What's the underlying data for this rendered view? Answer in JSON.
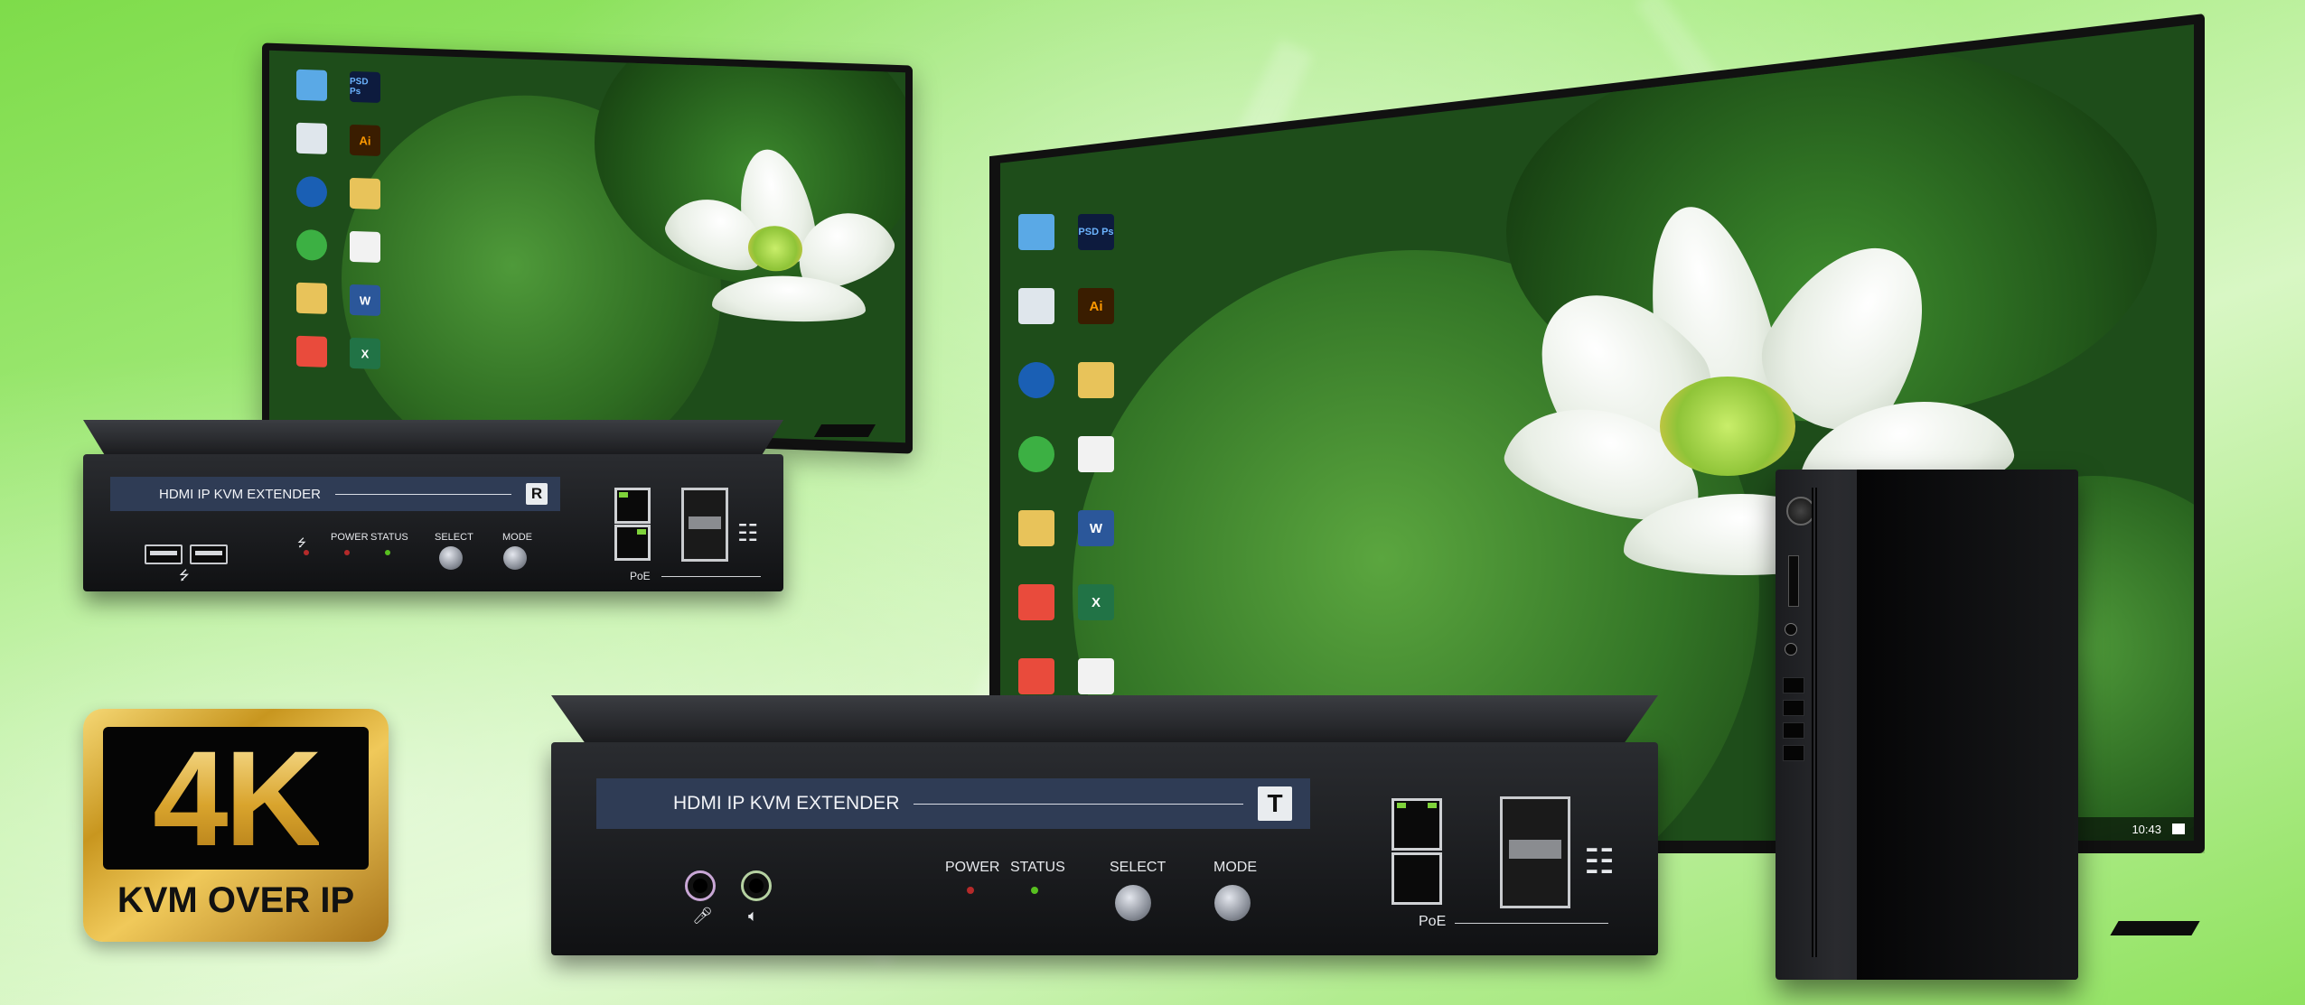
{
  "badge": {
    "big": "4K",
    "sub": "KVM OVER IP"
  },
  "receiver": {
    "title": "HDMI IP KVM EXTENDER",
    "unit_letter": "R",
    "usb_symbol": "⭍",
    "labels": {
      "power": "POWER",
      "status": "STATUS",
      "select": "SELECT",
      "mode": "MODE",
      "poe": "PoE"
    }
  },
  "transmitter": {
    "title": "HDMI IP KVM EXTENDER",
    "unit_letter": "T",
    "labels": {
      "power": "POWER",
      "status": "STATUS",
      "select": "SELECT",
      "mode": "MODE",
      "poe": "PoE"
    }
  },
  "screen": {
    "icons": [
      "PSD Ps",
      "Ai",
      "W",
      "X"
    ],
    "clock": "10:43"
  },
  "colors": {
    "background": "#9fe873",
    "device_body": "#1c1d20",
    "label_bar": "#2f3c55",
    "badge_gold": "#d9a42d",
    "led_green": "#58c020",
    "led_red": "#b52a2a"
  }
}
